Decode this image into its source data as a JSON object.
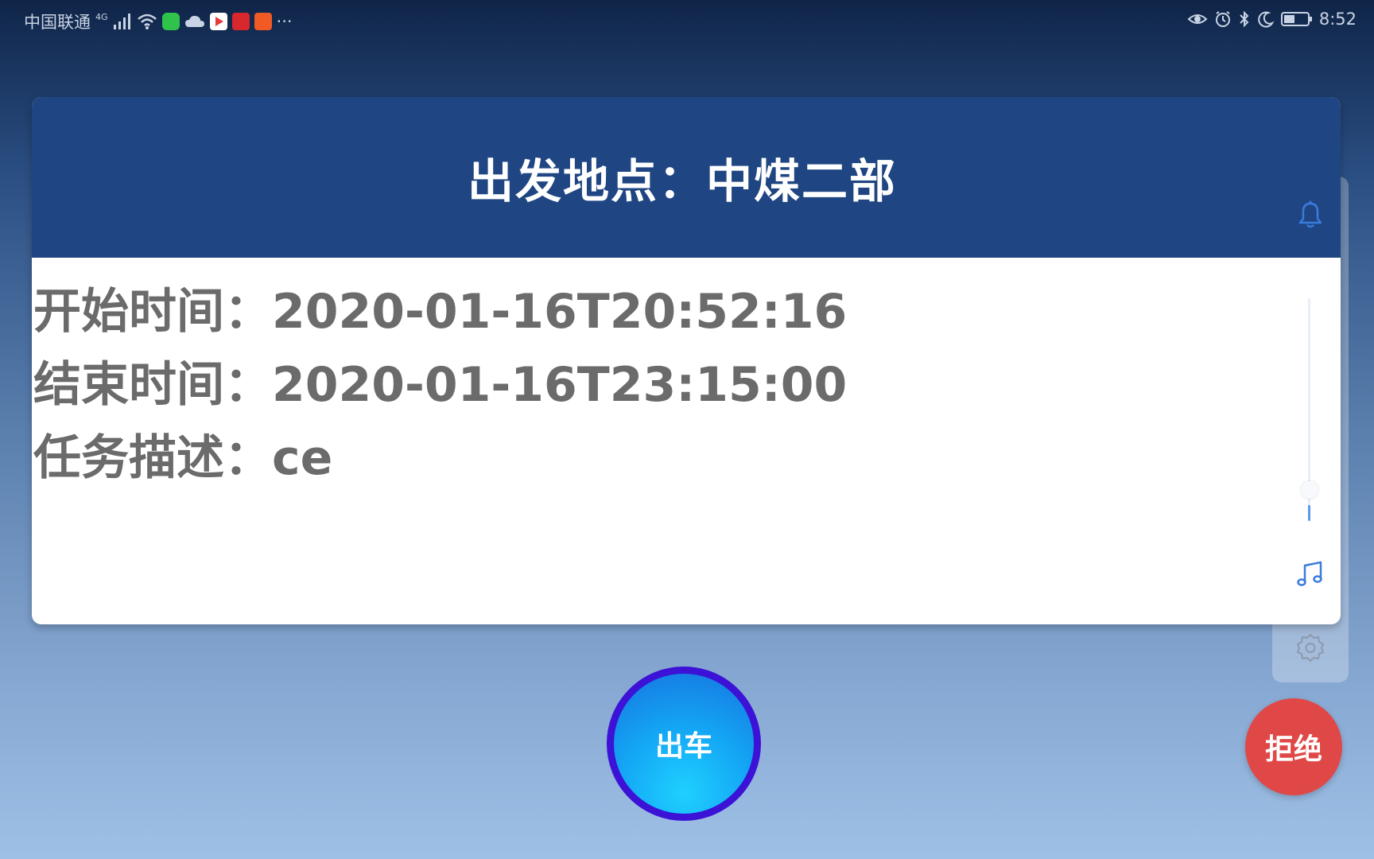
{
  "status_bar": {
    "carrier": "中国联通",
    "network": "4G",
    "more": "···",
    "time": "8:52"
  },
  "task": {
    "header": "出发地点：中煤二部",
    "start_time_line": "开始时间：2020-01-16T20:52:16",
    "end_time_line": "结束时间：2020-01-16T23:15:00",
    "description_line": "任务描述：ce"
  },
  "actions": {
    "depart_label": "出车",
    "reject_label": "拒绝"
  },
  "floating_panel": {
    "icons": [
      "bell-icon",
      "music-note-icon",
      "gear-icon"
    ],
    "volume_level": 0.1
  },
  "colors": {
    "header_bg": "#1f4683",
    "depart_ring": "#3b12d6",
    "depart_fill": "#14a8f5",
    "reject_bg": "#e04848"
  }
}
